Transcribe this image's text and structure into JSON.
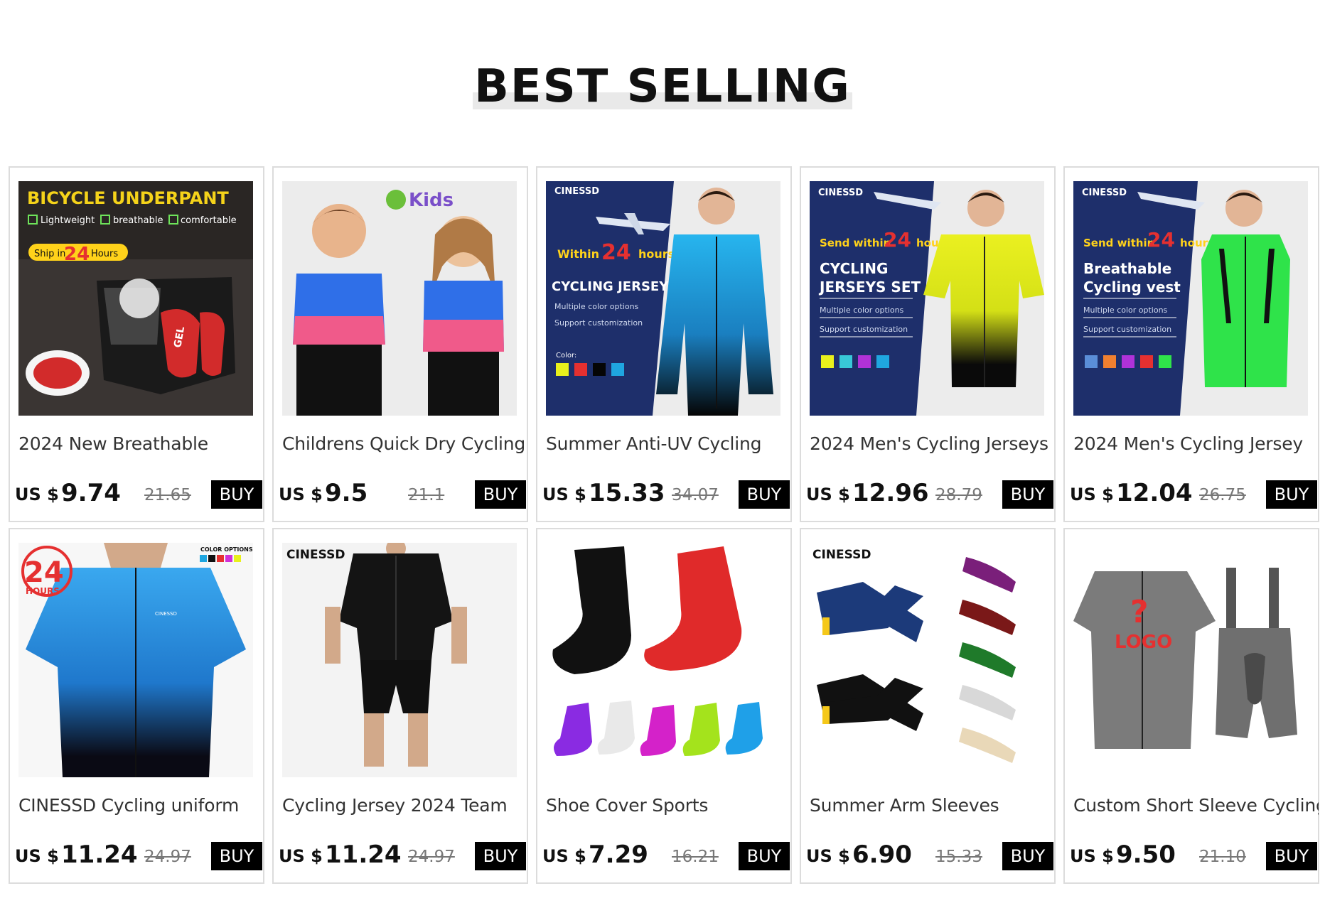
{
  "section": {
    "title": "BEST SELLING"
  },
  "currency_label": "US $",
  "buy_label": "BUY",
  "products": [
    {
      "title": "2024 New Breathable",
      "price": "9.74",
      "old_price": "21.65",
      "image": {
        "lines": [
          "BICYCLE UNDERPANT",
          "Lightweight",
          "breathable",
          "comfortable",
          "Ship in",
          "24",
          "Hours",
          "GEL"
        ]
      }
    },
    {
      "title": "Childrens Quick Dry Cycling",
      "price": "9.5",
      "old_price": "21.1",
      "image": {
        "lines": [
          "Kids"
        ]
      }
    },
    {
      "title": "Summer Anti-UV Cycling",
      "price": "15.33",
      "old_price": "34.07",
      "image": {
        "lines": [
          "CINESSD",
          "Within",
          "24",
          "hours",
          "CYCLING JERSEY",
          "Multiple color options",
          "Support customization",
          "Color:"
        ]
      }
    },
    {
      "title": "2024 Men's Cycling Jerseys",
      "price": "12.96",
      "old_price": "28.79",
      "image": {
        "lines": [
          "CINESSD",
          "Send within",
          "24",
          "hours",
          "CYCLING",
          "JERSEYS SET",
          "Multiple color options",
          "Support customization"
        ]
      }
    },
    {
      "title": "2024 Men's Cycling Jersey",
      "price": "12.04",
      "old_price": "26.75",
      "image": {
        "lines": [
          "CINESSD",
          "Send within",
          "24",
          "hours",
          "Breathable",
          "Cycling vest",
          "Multiple color options",
          "Support customization"
        ]
      }
    },
    {
      "title": "CINESSD Cycling uniform",
      "price": "11.24",
      "old_price": "24.97",
      "image": {
        "lines": [
          "24",
          "HOURS",
          "COLOR OPTIONS:",
          "CINESSD"
        ]
      }
    },
    {
      "title": "Cycling Jersey 2024 Team",
      "price": "11.24",
      "old_price": "24.97",
      "image": {
        "lines": [
          "CINESSD"
        ]
      }
    },
    {
      "title": "Shoe Cover Sports",
      "price": "7.29",
      "old_price": "16.21",
      "image": {
        "lines": []
      }
    },
    {
      "title": "Summer Arm Sleeves",
      "price": "6.90",
      "old_price": "15.33",
      "image": {
        "lines": [
          "CINESSD"
        ]
      }
    },
    {
      "title": "Custom Short Sleeve Cycling",
      "price": "9.50",
      "old_price": "21.10",
      "image": {
        "lines": [
          "?",
          "LOGO"
        ]
      }
    }
  ],
  "colors": {
    "banner_blue": "#1e2f6b",
    "accent_yellow": "#ffd21a",
    "jersey_blue": "#1fa6e0",
    "jersey_yellow": "#e9f01c",
    "vest_green": "#2fe34a",
    "pink": "#ee5a8a",
    "red": "#e53030"
  }
}
